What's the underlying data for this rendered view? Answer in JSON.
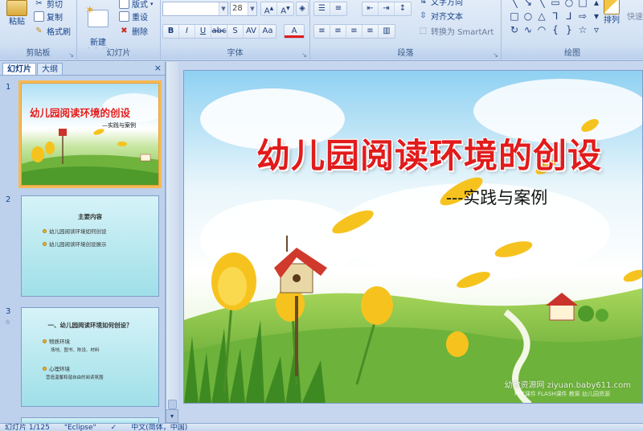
{
  "ribbon": {
    "clipboard": {
      "label": "剪贴板",
      "paste": "粘贴",
      "cut": "剪切",
      "copy": "复制",
      "format_painter": "格式刷"
    },
    "slides": {
      "label": "幻灯片",
      "new_slide": "新建\n幻灯片",
      "layout": "版式",
      "reset": "重设",
      "delete": "删除"
    },
    "font": {
      "label": "字体",
      "font_name": "",
      "font_size": "28"
    },
    "paragraph": {
      "label": "段落",
      "text_direction": "文字方向",
      "align_text": "对齐文本",
      "smartart": "转换为 SmartArt"
    },
    "drawing": {
      "label": "绘图",
      "arrange": "排列",
      "quick_styles": "快速"
    }
  },
  "panel": {
    "tab_slides": "幻灯片",
    "tab_outline": "大纲",
    "close": "×"
  },
  "thumbnails": [
    {
      "number": "1",
      "title": "幼儿园阅读环境的创设",
      "subtitle": "—实践与案例"
    },
    {
      "number": "2",
      "heading": "主要内容",
      "items": [
        "幼儿园阅读环境如何创设",
        "幼儿园阅读环境创设展示"
      ]
    },
    {
      "number": "3",
      "star": "☆",
      "heading": "一、幼儿园阅读环境如何创设？",
      "items": [
        "物质环境",
        "心理环境"
      ],
      "subitems": [
        "场地、图书、陈设、材料",
        "营造温馨和谐自由的阅读氛围"
      ]
    }
  ],
  "slide": {
    "title": "幼儿园阅读环境的创设",
    "subtitle": "---实践与案例",
    "watermark": "幼教资源网 ziyuan.baby611.com",
    "watermark_small": "PPT课件 FLASH课件 教案 幼儿园资源"
  },
  "status": {
    "slide_counter": "幻灯片 1/125",
    "theme": "\"Eclipse\"",
    "language": "中文(简体，中国)"
  },
  "colors": {
    "title_red": "#e21b1b",
    "selected_outline": "#f5b955",
    "ribbon_bg": "#d4e2f4"
  }
}
